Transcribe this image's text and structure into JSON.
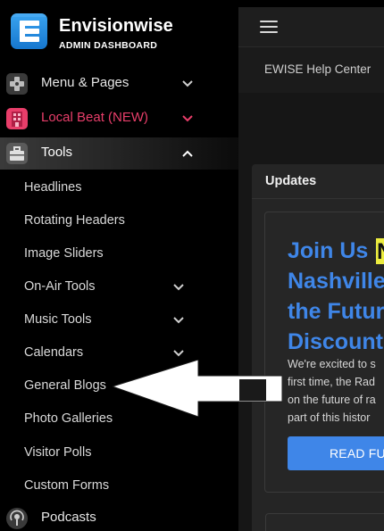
{
  "brand": {
    "name": "Envisionwise",
    "subtitle": "ADMIN DASHBOARD",
    "accent": "#1e88e5"
  },
  "sidebar": {
    "items": [
      {
        "label": "Menu & Pages",
        "icon": "gamepad-icon",
        "state": "collapsed"
      },
      {
        "label": "Local Beat (NEW)",
        "icon": "building-icon",
        "state": "collapsed",
        "color": "#e83e6a"
      },
      {
        "label": "Tools",
        "icon": "toolbox-icon",
        "state": "expanded"
      }
    ],
    "tools_submenu": [
      {
        "label": "Headlines"
      },
      {
        "label": "Rotating Headers"
      },
      {
        "label": "Image Sliders"
      },
      {
        "label": "On-Air Tools",
        "has_children": true
      },
      {
        "label": "Music Tools",
        "has_children": true
      },
      {
        "label": "Calendars",
        "has_children": true
      },
      {
        "label": "General Blogs",
        "highlighted_by_arrow": true
      },
      {
        "label": "Photo Galleries"
      },
      {
        "label": "Visitor Polls"
      },
      {
        "label": "Custom Forms"
      }
    ],
    "podcasts": {
      "label": "Podcasts",
      "icon": "podcast-icon"
    }
  },
  "topbar": {
    "menu_icon": "hamburger-icon"
  },
  "help": {
    "title": "EWISE Help Center"
  },
  "updates": {
    "heading": "Updates",
    "headline_lines": [
      "Join Us N",
      "Nashville",
      "the Futur",
      "Discount"
    ],
    "headline_highlight": "N",
    "paragraph_lines": [
      "We're excited to s",
      "first time, the Rad",
      "on the future of ra",
      "part of this histor"
    ],
    "button_label": "READ FU",
    "colors": {
      "headline": "#3f86e8",
      "highlight": "#ecec3f",
      "button": "#3f86e8"
    }
  }
}
